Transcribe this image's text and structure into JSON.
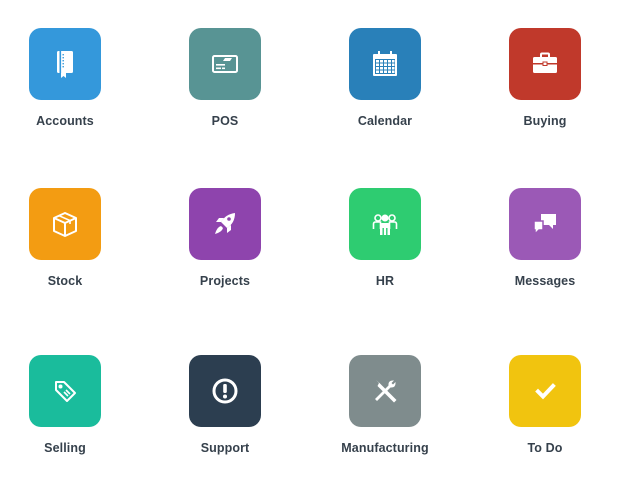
{
  "modules": [
    {
      "label": "Accounts",
      "icon": "book-icon",
      "color": "#3498db"
    },
    {
      "label": "POS",
      "icon": "credit-card-icon",
      "color": "#589494"
    },
    {
      "label": "Calendar",
      "icon": "calendar-icon",
      "color": "#2980b9"
    },
    {
      "label": "Buying",
      "icon": "briefcase-icon",
      "color": "#c0392b"
    },
    {
      "label": "Stock",
      "icon": "box-icon",
      "color": "#f39c12"
    },
    {
      "label": "Projects",
      "icon": "rocket-icon",
      "color": "#8e44ad"
    },
    {
      "label": "HR",
      "icon": "group-icon",
      "color": "#2ecc71"
    },
    {
      "label": "Messages",
      "icon": "chat-bubbles-icon",
      "color": "#9b59b6"
    },
    {
      "label": "Selling",
      "icon": "tag-icon",
      "color": "#1abc9c"
    },
    {
      "label": "Support",
      "icon": "exclamation-circle-icon",
      "color": "#2c3e50"
    },
    {
      "label": "Manufacturing",
      "icon": "tools-icon",
      "color": "#7f8c8d"
    },
    {
      "label": "To Do",
      "icon": "check-icon",
      "color": "#f1c40f"
    }
  ]
}
